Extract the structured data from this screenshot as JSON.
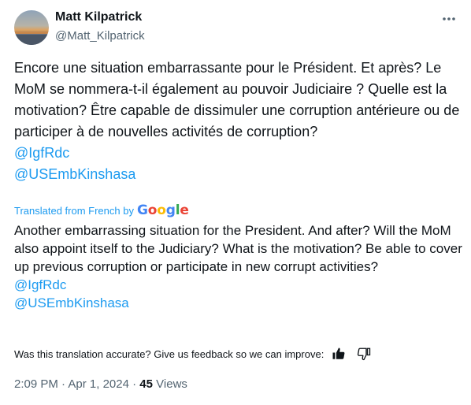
{
  "author": {
    "name": "Matt Kilpatrick",
    "handle": "@Matt_Kilpatrick"
  },
  "menu_icon": "more-horizontal-icon",
  "original_tweet": {
    "paragraph": "Encore une situation embarrassante pour le Président. Et après? Le MoM se nommera-t-il également au pouvoir Judiciaire ? Quelle est la motivation? Être capable de dissimuler une corruption antérieure ou de participer à de nouvelles activités de corruption?",
    "mentions": [
      "@IgfRdc",
      "@USEmbKinshasa"
    ]
  },
  "translation": {
    "label": "Translated from French by",
    "provider": "Google",
    "paragraph": "Another embarrassing situation for the President. And after? Will the MoM also appoint itself to the Judiciary? What is the motivation? Be able to cover up previous corruption or participate in new corrupt activities?",
    "mentions": [
      "@IgfRdc",
      "@USEmbKinshasa"
    ]
  },
  "feedback": {
    "question": "Was this translation accurate? Give us feedback so we can improve:",
    "icons": [
      "thumbs-up-icon",
      "thumbs-down-icon"
    ]
  },
  "meta": {
    "time": "2:09 PM",
    "date": "Apr 1, 2024",
    "views_count": "45",
    "views_label": "Views"
  },
  "colors": {
    "link": "#1d9bf0",
    "text": "#0f1419",
    "secondary": "#536471"
  }
}
